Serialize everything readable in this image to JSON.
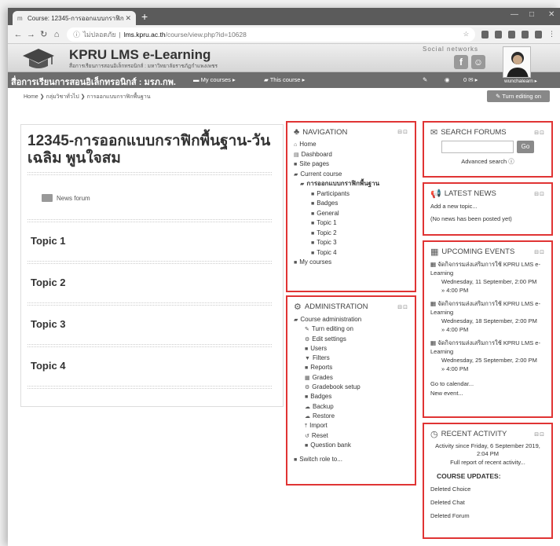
{
  "browser": {
    "tab_title": "Course: 12345-การออกแบบกราฟิก",
    "url_secure_label": "ไม่ปลอดภัย",
    "url_host": "lms.kpru.ac.th",
    "url_path": "/course/view.php?id=10628"
  },
  "site": {
    "name": "KPRU LMS e-Learning",
    "subtitle": "สื่อการเรียนการสอนอิเล็กทรอนิกส์ : มหาวิทยาลัยราชภัฏกำแพงเพชร",
    "social_title": "Social networks",
    "social_icons": [
      "facebook-icon",
      "line-icon"
    ],
    "username": "wunchalearn"
  },
  "navbar": {
    "title": "สื่อการเรียนการสอนอิเล็กทรอนิกส์ : มรภ.กพ.",
    "my_courses": "My courses",
    "this_course": "This course",
    "messages": "0"
  },
  "breadcrumb": {
    "home": "Home",
    "category": "กลุ่มวิชาทั่วไป",
    "course": "การออกแบบกราฟิกพื้นฐาน"
  },
  "edit_button": "Turn editing on",
  "course": {
    "title": "12345-การออกแบบกราฟิกพื้นฐาน-วันเฉลิม พูนใจสม",
    "news_forum": "News forum",
    "topics": [
      "Topic 1",
      "Topic 2",
      "Topic 3",
      "Topic 4"
    ]
  },
  "navigation": {
    "title": "NAVIGATION",
    "items": [
      {
        "label": "Home",
        "icon": "home-icon"
      },
      {
        "label": "Dashboard",
        "icon": "dashboard-icon"
      },
      {
        "label": "Site pages",
        "icon": "folder-icon"
      },
      {
        "label": "Current course",
        "icon": "folder-open-icon"
      },
      {
        "label": "การออกแบบกราฟิกพื้นฐาน",
        "icon": "folder-open-icon"
      },
      {
        "label": "Participants",
        "icon": "folder-icon"
      },
      {
        "label": "Badges",
        "icon": "folder-icon"
      },
      {
        "label": "General",
        "icon": "folder-icon"
      },
      {
        "label": "Topic 1",
        "icon": "folder-icon"
      },
      {
        "label": "Topic 2",
        "icon": "folder-icon"
      },
      {
        "label": "Topic 3",
        "icon": "folder-icon"
      },
      {
        "label": "Topic 4",
        "icon": "folder-icon"
      },
      {
        "label": "My courses",
        "icon": "folder-icon"
      }
    ]
  },
  "administration": {
    "title": "ADMINISTRATION",
    "items": [
      {
        "label": "Course administration",
        "icon": "folder-open-icon"
      },
      {
        "label": "Turn editing on",
        "icon": "pencil-icon"
      },
      {
        "label": "Edit settings",
        "icon": "cog-icon"
      },
      {
        "label": "Users",
        "icon": "folder-icon"
      },
      {
        "label": "Filters",
        "icon": "filter-icon"
      },
      {
        "label": "Reports",
        "icon": "folder-icon"
      },
      {
        "label": "Grades",
        "icon": "table-icon"
      },
      {
        "label": "Gradebook setup",
        "icon": "cog-icon"
      },
      {
        "label": "Badges",
        "icon": "folder-icon"
      },
      {
        "label": "Backup",
        "icon": "upload-icon"
      },
      {
        "label": "Restore",
        "icon": "download-icon"
      },
      {
        "label": "Import",
        "icon": "import-icon"
      },
      {
        "label": "Reset",
        "icon": "reset-icon"
      },
      {
        "label": "Question bank",
        "icon": "folder-icon"
      }
    ],
    "switch_role": "Switch role to..."
  },
  "search_forums": {
    "title": "SEARCH FORUMS",
    "go": "Go",
    "advanced": "Advanced search"
  },
  "latest_news": {
    "title": "LATEST NEWS",
    "add": "Add a new topic...",
    "empty": "(No news has been posted yet)"
  },
  "upcoming_events": {
    "title": "UPCOMING EVENTS",
    "events": [
      {
        "name": "จัดกิจกรรมส่งเสริมการใช้ KPRU LMS e-Learning",
        "date": "Wednesday, 11 September, 2:00 PM",
        "end": "» 4:00 PM"
      },
      {
        "name": "จัดกิจกรรมส่งเสริมการใช้ KPRU LMS e-Learning",
        "date": "Wednesday, 18 September, 2:00 PM",
        "end": "» 4:00 PM"
      },
      {
        "name": "จัดกิจกรรมส่งเสริมการใช้ KPRU LMS e-Learning",
        "date": "Wednesday, 25 September, 2:00 PM",
        "end": "» 4:00 PM"
      }
    ],
    "calendar": "Go to calendar...",
    "new_event": "New event..."
  },
  "recent_activity": {
    "title": "RECENT ACTIVITY",
    "since": "Activity since Friday, 6 September 2019, 2:04 PM",
    "full_report": "Full report of recent activity...",
    "updates_title": "COURSE UPDATES:",
    "updates": [
      "Deleted Choice",
      "Deleted Chat",
      "Deleted Forum"
    ]
  }
}
